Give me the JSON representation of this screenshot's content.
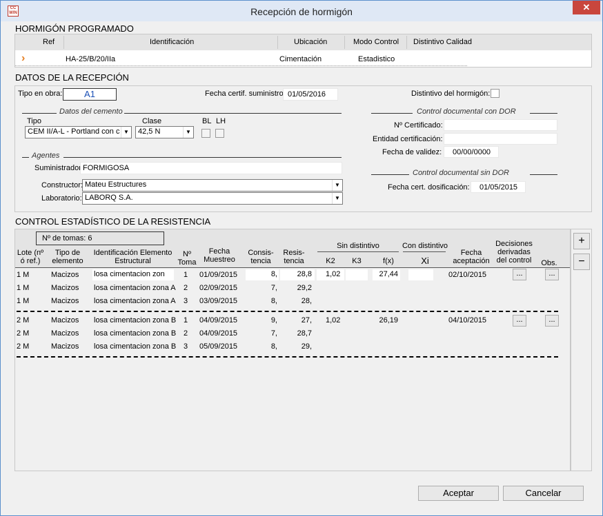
{
  "window": {
    "title": "Recepción de hormigón",
    "app_icon": "CC WIN",
    "close": "✕"
  },
  "programado": {
    "section_title": "HORMIGÓN PROGRAMADO",
    "headers": [
      "Ref",
      "Identificación",
      "Ubicación",
      "Modo Control",
      "Distintivo Calidad"
    ],
    "row": {
      "marker": "›",
      "ident": "HA-25/B/20/IIa",
      "ubicacion": "Cimentación",
      "modo": "Estadistico",
      "distintivo": ""
    }
  },
  "recepcion": {
    "section_title": "DATOS DE LA RECEPCIÓN",
    "tipo_obra_label": "Tipo en obra:",
    "tipo_obra_value": "A1",
    "fecha_cert_label": "Fecha certif. suministro:",
    "fecha_cert_value": "01/05/2016",
    "distintivo_label": "Distintivo del hormigón:",
    "cemento_title": "Datos del cemento",
    "tipo_label": "Tipo",
    "tipo_value": "CEM II/A-L - Portland con c",
    "clase_label": "Clase",
    "clase_value": "42,5 N",
    "bl_label": "BL",
    "lh_label": "LH",
    "agentes_title": "Agentes",
    "suministrador_label": "Suministrador:",
    "suministrador_value": "FORMIGOSA",
    "constructor_label": "Constructor:",
    "constructor_value": "Mateu Estructures",
    "laboratorio_label": "Laboratorio:",
    "laboratorio_value": "LABORQ S.A.",
    "dor_title": "Control documental  con DOR",
    "n_cert_label": "Nº Certificado:",
    "n_cert_value": "",
    "entidad_label": "Entidad certificación:",
    "entidad_value": "",
    "fecha_validez_label": "Fecha de validez:",
    "fecha_validez_value": "00/00/0000",
    "sin_dor_title": "Control documental  sin DOR",
    "fecha_dosif_label": "Fecha cert. dosificación:",
    "fecha_dosif_value": "01/05/2015"
  },
  "control": {
    "section_title": "CONTROL ESTADÍSTICO DE LA RESISTENCIA",
    "tomas_label": "Nº de tomas: 6",
    "headers": {
      "lote": "Lote (nº ó ref.)",
      "tipo": "Tipo de elemento",
      "ident": "Identificación Elemento Estructural",
      "toma": "Nº Toma",
      "fecha": "Fecha Muestreo",
      "consis": "Consis- tencia",
      "resis": "Resis- tencia",
      "sin_dist": "Sin distintivo",
      "k2": "K2",
      "k3": "K3",
      "fx": "f(x)",
      "con_dist": "Con distintivo",
      "xi": "Xi",
      "fecha_acep": "Fecha aceptación",
      "decisiones": "Decisiones derivadas del control",
      "obs": "Obs."
    },
    "rows": [
      {
        "lote": "1 M",
        "tipo": "Macizos",
        "ident": "losa cimentacion zon",
        "toma": "1",
        "fecha": "01/09/2015",
        "consis": "8,",
        "resis": "28,8",
        "k2": "1,02",
        "k3": "",
        "fx": "27,44",
        "xi": "",
        "fecha_acep": "02/10/2015",
        "dec": "...",
        "obs": "..."
      },
      {
        "lote": "1 M",
        "tipo": "Macizos",
        "ident": "losa cimentacion zona A",
        "toma": "2",
        "fecha": "02/09/2015",
        "consis": "7,",
        "resis": "29,2"
      },
      {
        "lote": "1 M",
        "tipo": "Macizos",
        "ident": "losa cimentacion zona A",
        "toma": "3",
        "fecha": "03/09/2015",
        "consis": "8,",
        "resis": "28,"
      },
      {
        "lote": "2 M",
        "tipo": "Macizos",
        "ident": "losa cimentacion zona B",
        "toma": "1",
        "fecha": "04/09/2015",
        "consis": "9,",
        "resis": "27,",
        "k2": "1,02",
        "fx": "26,19",
        "fecha_acep": "04/10/2015",
        "dec": "...",
        "obs": "..."
      },
      {
        "lote": "2 M",
        "tipo": "Macizos",
        "ident": "losa cimentacion zona B",
        "toma": "2",
        "fecha": "04/09/2015",
        "consis": "7,",
        "resis": "28,7"
      },
      {
        "lote": "2 M",
        "tipo": "Macizos",
        "ident": "losa cimentacion zona B",
        "toma": "3",
        "fecha": "05/09/2015",
        "consis": "8,",
        "resis": "29,"
      }
    ],
    "add_label": "+",
    "remove_label": "−"
  },
  "footer": {
    "accept_label": "Aceptar",
    "cancel_label": "Cancelar"
  }
}
